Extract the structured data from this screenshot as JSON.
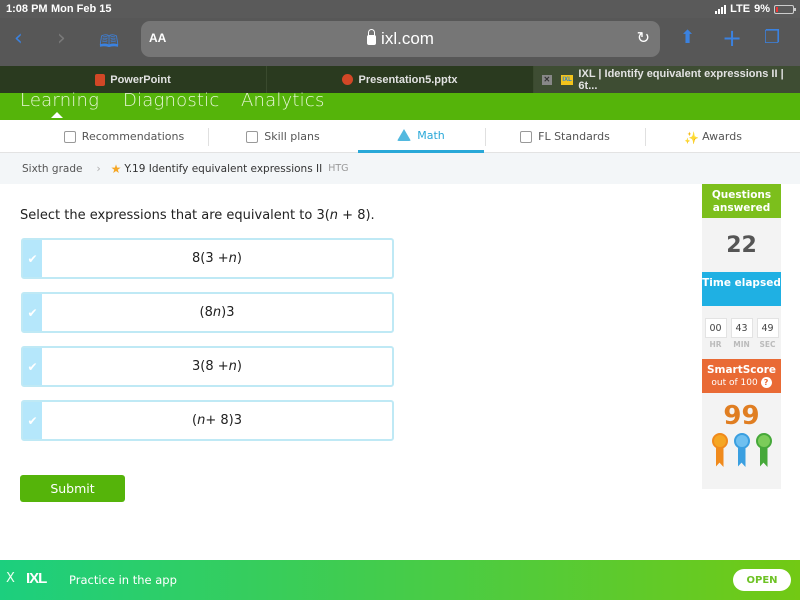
{
  "status_bar": {
    "time": "1:08 PM",
    "date": "Mon Feb 15",
    "network": "LTE",
    "battery": "9%"
  },
  "browser": {
    "text_size_label": "AA",
    "url_host": "ixl.com",
    "icons": [
      "back-icon",
      "forward-icon",
      "bookmarks-icon",
      "lock-icon",
      "reload-icon",
      "share-icon",
      "new-tab-icon",
      "tabs-icon"
    ],
    "tabs": [
      {
        "label": "PowerPoint",
        "active": false
      },
      {
        "label": "Presentation5.pptx",
        "active": false
      },
      {
        "label": "IXL | Identify equivalent expressions II | 6t...",
        "active": true
      }
    ]
  },
  "ixl_nav": {
    "items": [
      "Learning",
      "Diagnostic",
      "Analytics"
    ],
    "active": "Learning"
  },
  "subject_nav": {
    "items": [
      {
        "label": "Recommendations",
        "icon": "signpost-icon"
      },
      {
        "label": "Skill plans",
        "icon": "clipboard-icon"
      },
      {
        "label": "Math",
        "icon": "pyramid-icon",
        "active": true
      },
      {
        "label": "FL Standards",
        "icon": "checklist-icon"
      },
      {
        "label": "Awards",
        "icon": "confetti-icon"
      }
    ]
  },
  "breadcrumb": {
    "grade": "Sixth grade",
    "skill": "Y.19 Identify equivalent expressions II",
    "tag": "HTG"
  },
  "question": {
    "prompt_prefix": "Select the expressions that are equivalent to 3(",
    "prompt_var": "n",
    "prompt_suffix": " + 8).",
    "choices": [
      {
        "pre": "8(3 + ",
        "var": "n",
        "post": ")"
      },
      {
        "pre": "(8",
        "var": "n",
        "post": ")3"
      },
      {
        "pre": "3(8 + ",
        "var": "n",
        "post": ")"
      },
      {
        "pre": "(",
        "var": "n",
        "post": " + 8)3"
      }
    ],
    "submit_label": "Submit"
  },
  "sidebar": {
    "questions_answered_label": "Questions answered",
    "questions_answered": "22",
    "time_elapsed_label": "Time elapsed",
    "time": {
      "hr": "00",
      "min": "43",
      "sec": "49"
    },
    "time_units": {
      "hr": "HR",
      "min": "MIN",
      "sec": "SEC"
    },
    "smartscore_label": "SmartScore",
    "smartscore_sub": "out of 100",
    "help_glyph": "?",
    "smartscore": "99",
    "medal_colors": [
      "#f08a1c",
      "#3a9fe0",
      "#46a83a"
    ]
  },
  "app_banner": {
    "close_glyph": "X",
    "logo": "IXL",
    "message": "Practice in the app",
    "open_label": "OPEN"
  }
}
